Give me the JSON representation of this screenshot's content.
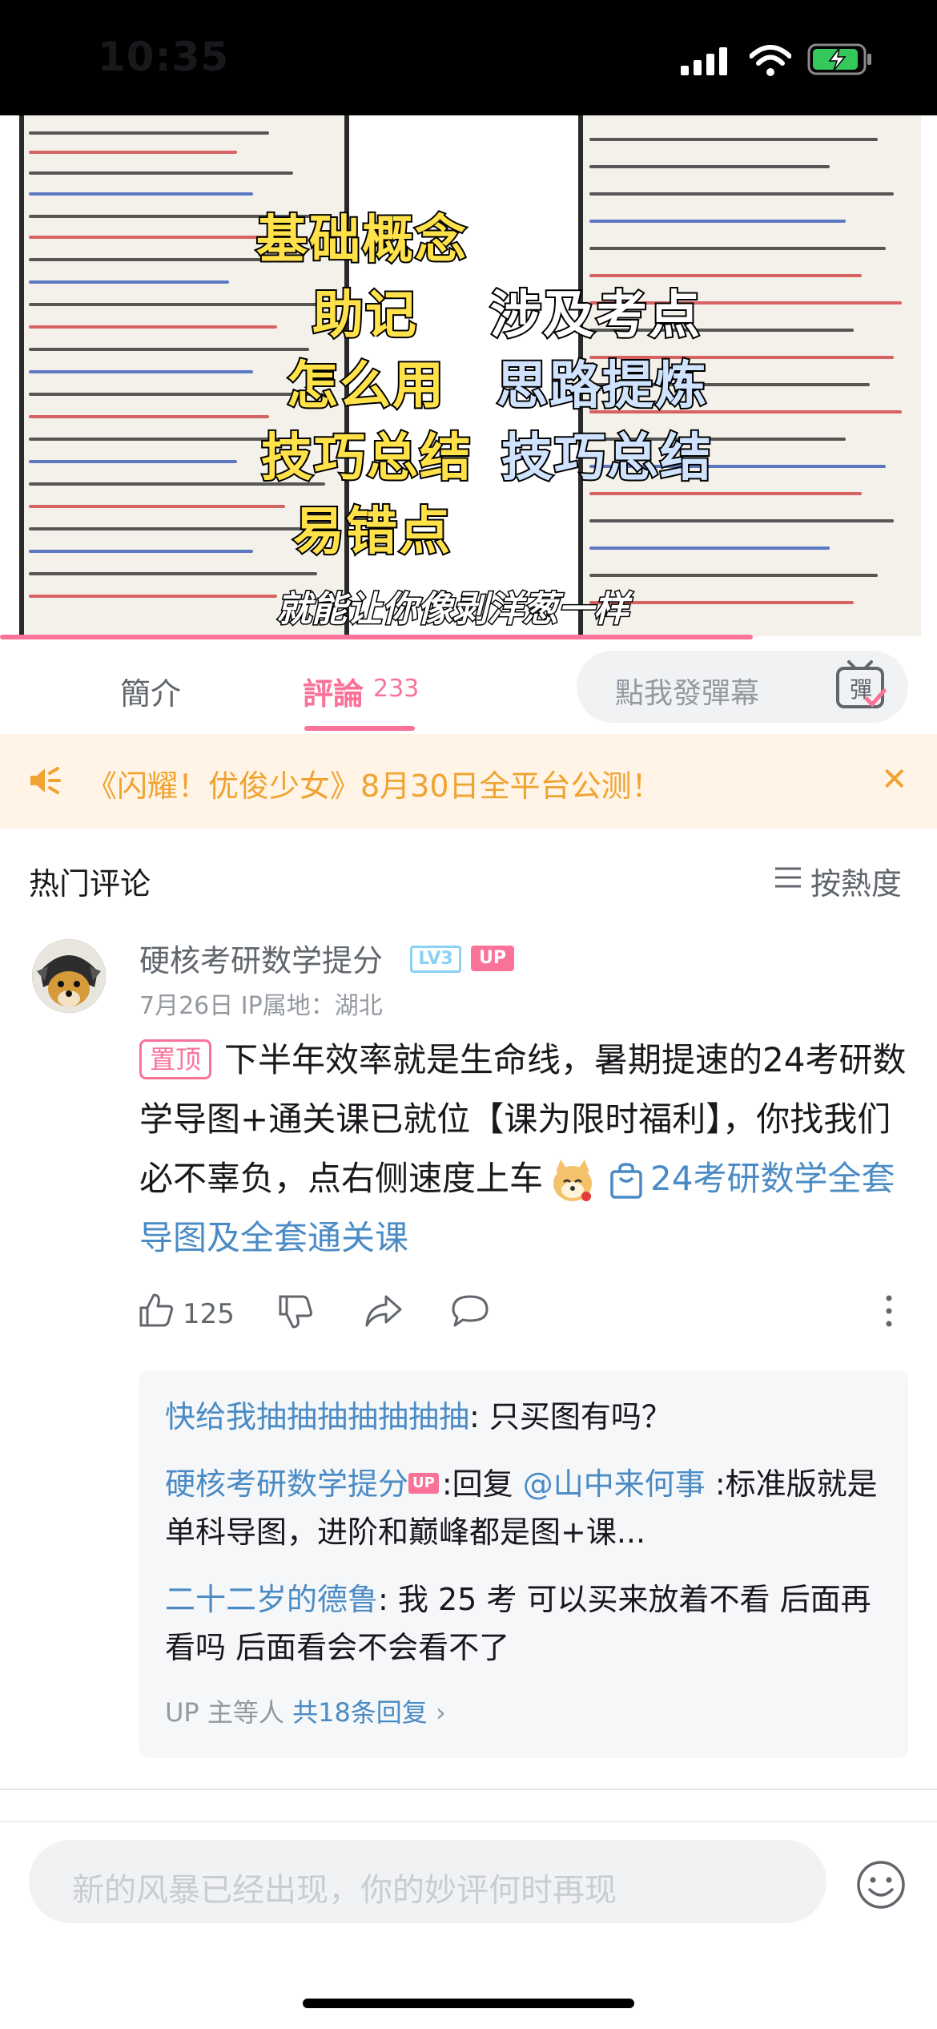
{
  "status_bar": {
    "time": "10:35"
  },
  "video": {
    "overlay": {
      "left": [
        "基础概念",
        "助记",
        "怎么用",
        "技巧总结",
        "易错点"
      ],
      "right": [
        "涉及考点",
        "思路提炼",
        "技巧总结"
      ]
    },
    "caption": "就能让你像剥洋葱一样"
  },
  "tabs": {
    "intro": "簡介",
    "comments": "評論",
    "comments_count": "233",
    "danmaku_placeholder": "點我發彈幕",
    "danmaku_toggle": "彈"
  },
  "banner": {
    "text": "《闪耀！优俊少女》8月30日全平台公测！",
    "close": "✕"
  },
  "comments_header": {
    "title": "热门评论",
    "sort_label": "按熱度"
  },
  "comment": {
    "username": "硬核考研数学提分",
    "level": "LV3",
    "up_badge": "UP",
    "meta": "7月26日  IP属地：湖北",
    "pin_tag": "置顶",
    "text": "下半年效率就是生命线，暑期提速的24考研数学导图+通关课已就位【课为限时福利】，你找我们必不辜负，点右侧速度上车",
    "link_text": "24考研数学全套导图及全套通关课",
    "likes": "125"
  },
  "replies": [
    {
      "user": "快给我抽抽抽抽抽抽抽",
      "text": ": 只买图有吗？"
    },
    {
      "user": "硬核考研数学提分",
      "badge": "UP",
      "text_prefix": ":回复 ",
      "mention": "@山中来何事",
      "text": " :标准版就是单科导图，进阶和巅峰都是图+课..."
    },
    {
      "user": "二十二岁的德鲁",
      "text": ": 我 25 考 可以买来放着不看 后面再看吗  后面看会不会看不了"
    }
  ],
  "reply_footer": {
    "prefix": "UP 主等人 ",
    "total": "共18条回复",
    "arrow": "›"
  },
  "input": {
    "placeholder": "新的风暴已经出现，你的妙评何时再现"
  },
  "colors": {
    "accent": "#fb7299",
    "link": "#4a8bc5",
    "banner_bg": "#fff4e6",
    "banner_text": "#f0a330"
  }
}
